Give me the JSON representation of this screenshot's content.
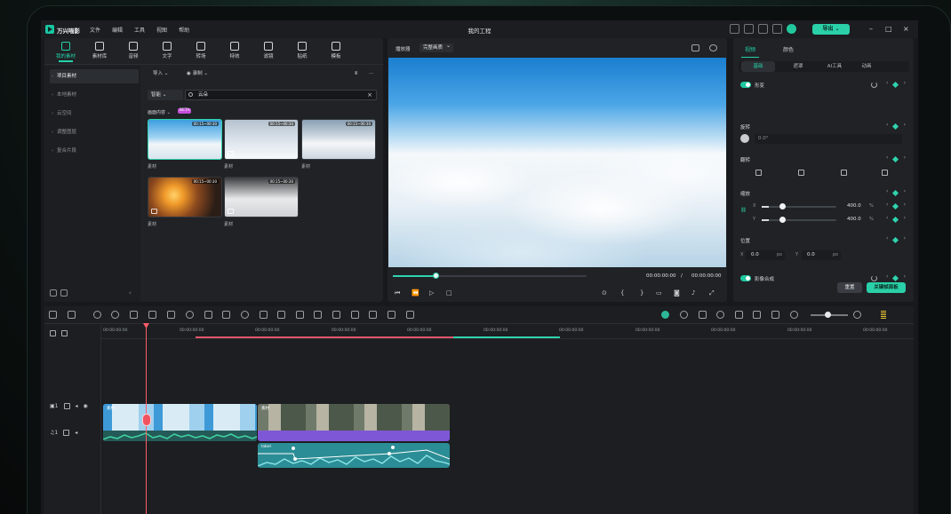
{
  "app": {
    "name": "万兴喵影",
    "project_title": "我的工程",
    "menu": [
      "文件",
      "编辑",
      "工具",
      "视图",
      "帮助"
    ],
    "export_label": "导出"
  },
  "media_panel": {
    "tabs": [
      {
        "label": "我的素材",
        "icon": "folder-media-icon",
        "active": true
      },
      {
        "label": "素材库",
        "icon": "library-icon"
      },
      {
        "label": "音频",
        "icon": "music-note-icon"
      },
      {
        "label": "文字",
        "icon": "text-t-icon"
      },
      {
        "label": "转场",
        "icon": "transition-icon"
      },
      {
        "label": "特效",
        "icon": "sparkle-icon"
      },
      {
        "label": "滤镜",
        "icon": "filter-icon"
      },
      {
        "label": "贴纸",
        "icon": "sticker-icon"
      },
      {
        "label": "模板",
        "icon": "template-icon"
      }
    ],
    "nav": [
      "项目素材",
      "本地素材",
      "云空间",
      "调整图层",
      "复合片段"
    ],
    "import_label": "导入",
    "record_label": "录制",
    "search": {
      "mode": "智能",
      "query": "云朵"
    },
    "section_title": "画面内容",
    "section_badge": "BETA",
    "thumbnails": [
      {
        "duration": "00:15~00:30",
        "label": "素材",
        "selected": true
      },
      {
        "duration": "00:15~00:30",
        "label": "素材"
      },
      {
        "duration": "00:15~00:30",
        "label": "素材"
      },
      {
        "duration": "00:15~00:30",
        "label": "素材"
      },
      {
        "duration": "00:15~00:30",
        "label": "素材"
      }
    ]
  },
  "player": {
    "label": "播放器",
    "quality": "完整画质",
    "current_time": "00:00:00:00",
    "separator": "/",
    "total_time": "00:00:00:00",
    "progress": 0.22
  },
  "properties": {
    "tabs": [
      "视频",
      "颜色"
    ],
    "subtabs": [
      "基础",
      "遮罩",
      "AI工具",
      "动画"
    ],
    "transform_label": "形变",
    "rotate_label": "旋转",
    "rotate_value": "0.0°",
    "flip_label": "翻转",
    "scale_label": "缩放",
    "scale_x_axis": "X",
    "scale_y_axis": "Y",
    "scale_x": "400.0",
    "scale_y": "400.0",
    "percent_unit": "%",
    "scale_x_level": 0.1,
    "scale_y_level": 0.1,
    "position_label": "位置",
    "pos_x_axis": "X",
    "pos_y_axis": "Y",
    "pos_x": "0.0",
    "pos_y": "0.0",
    "px_unit": "px",
    "composite_label": "影像合成",
    "reset_label": "重置",
    "keyframe_panel_label": "关键帧面板"
  },
  "timeline": {
    "ruler": [
      "00:00:00:00",
      "00:00:00:00",
      "00:00:00:00",
      "00:00:00:00",
      "00:00:00:00",
      "00:00:00:00",
      "00:00:00:00",
      "00:00:00:00",
      "00:00:00:00",
      "00:00:00:00",
      "00:00:00:00"
    ],
    "video_track_label": "1",
    "audio_track_label": "1",
    "clip1_label": "素材",
    "clip2_label": "素材",
    "audio_clip_label": "label"
  },
  "colors": {
    "accent": "#23d1a8",
    "playhead": "#ff5c6a",
    "clip_video": "#5fc9df",
    "clip_purple": "#7e57d6",
    "audio": "#2ba8b3"
  }
}
